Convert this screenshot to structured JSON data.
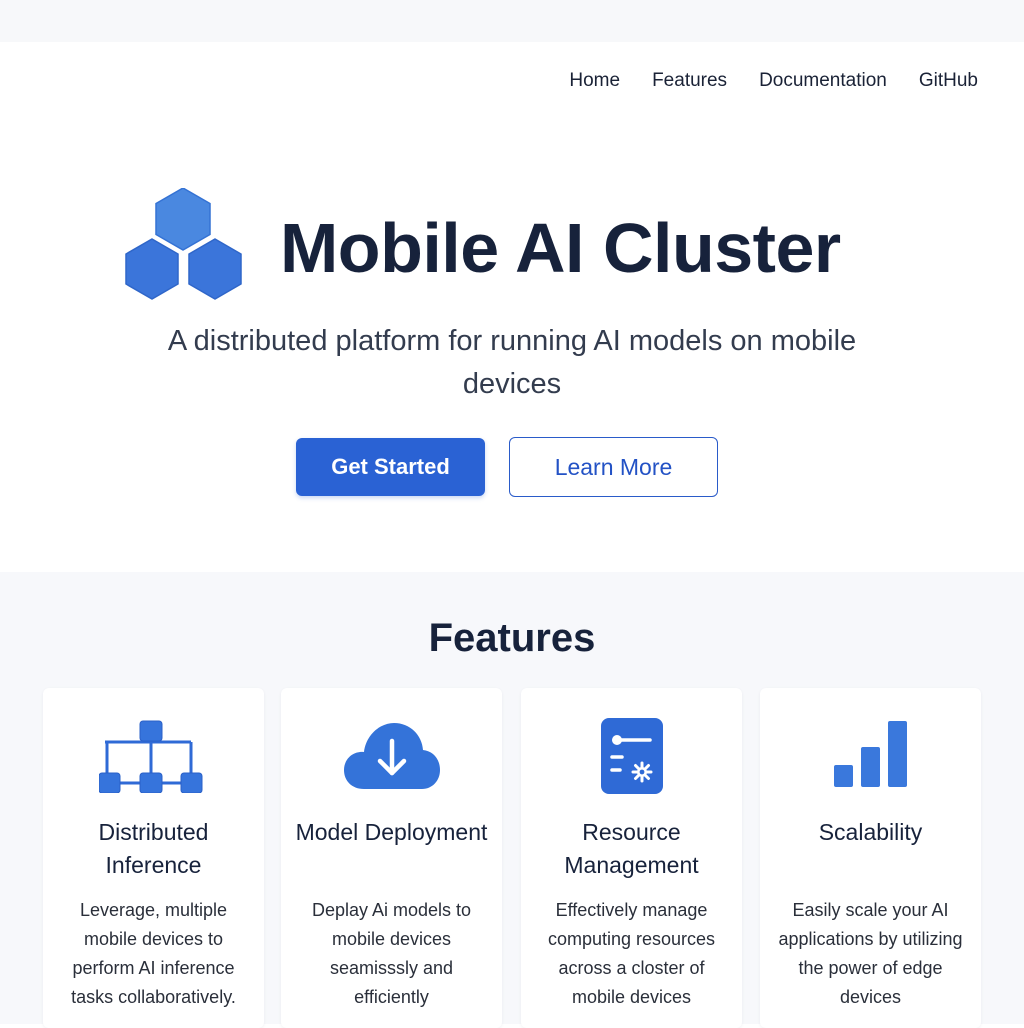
{
  "nav": {
    "links": [
      "Home",
      "Features",
      "Documentation",
      "GitHub"
    ]
  },
  "hero": {
    "title": "Mobile AI Cluster",
    "subtitle": "A distributed platform for running AI models on mobile devices",
    "primary_button": "Get Started",
    "secondary_button": "Learn More"
  },
  "features": {
    "title": "Features",
    "cards": [
      {
        "icon": "network-icon",
        "title": "Distributed Inference",
        "description": "Leverage, multiple mobile devices to perform AI inference tasks collaboratively."
      },
      {
        "icon": "cloud-download-icon",
        "title": "Model Deployment",
        "description": "Deplay Ai models to mobile devices seamisssly and efficiently"
      },
      {
        "icon": "settings-document-icon",
        "title": "Resource Management",
        "description": "Effectively manage computing resources across a closter of mobile devices"
      },
      {
        "icon": "bar-chart-icon",
        "title": "Scalability",
        "description": "Easily scale your AI applications by utilizing the power of edge devices"
      }
    ]
  },
  "colors": {
    "accent": "#2a62d4",
    "heading": "#17223b",
    "section_bg": "#f7f8fb"
  }
}
